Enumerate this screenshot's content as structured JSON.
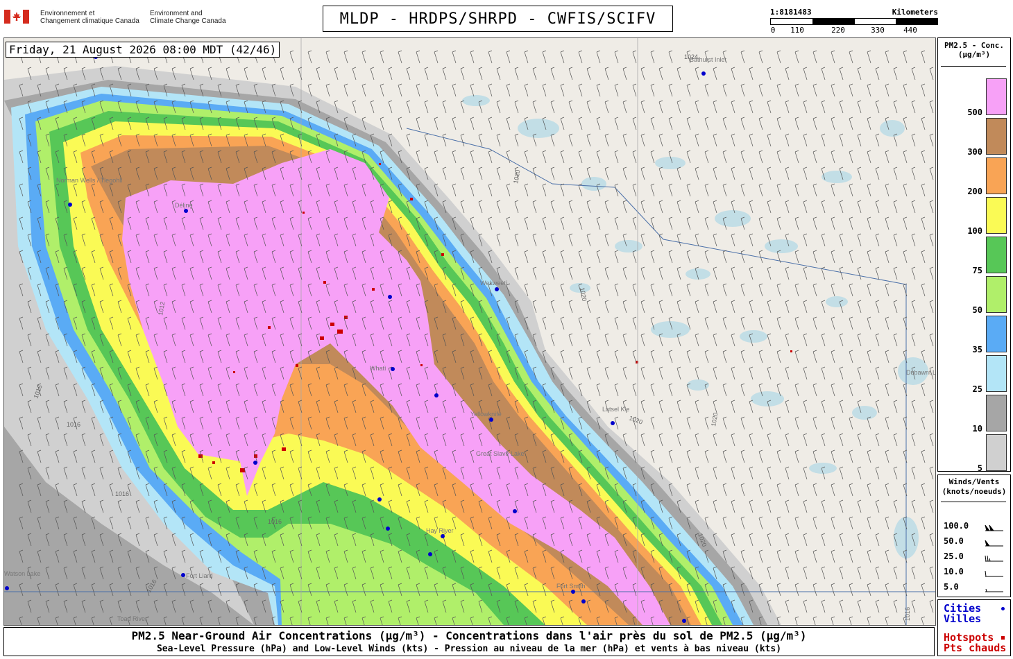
{
  "header": {
    "agency_fr_line1": "Environnement et",
    "agency_fr_line2": "Changement climatique Canada",
    "agency_en_line1": "Environment and",
    "agency_en_line2": "Climate Change Canada",
    "title": "MLDP - HRDPS/SHRPD - CWFIS/SCIFV"
  },
  "scale_bar": {
    "ratio": "1:8181483",
    "unit": "Kilometers",
    "ticks": [
      "0",
      "110",
      "220",
      "330",
      "440"
    ]
  },
  "map": {
    "datetime": "Friday, 21 August 2026 08:00 MDT (42/46)",
    "places": [
      {
        "name": "Norman Wells / Tlegohli"
      },
      {
        "name": "Délįnę"
      },
      {
        "name": "Bathurst Inlet"
      },
      {
        "name": "Wekweètì"
      },
      {
        "name": "Whatì"
      },
      {
        "name": "Yellowknife"
      },
      {
        "name": "Great Slave Lake"
      },
      {
        "name": "Hay River"
      },
      {
        "name": "Fort Liard"
      },
      {
        "name": "Fort Smith"
      },
      {
        "name": "Toad River"
      },
      {
        "name": "Dubawnt Lake"
      },
      {
        "name": "Lutsel K'e"
      },
      {
        "name": "Watson Lake"
      }
    ],
    "isobar_labels": [
      "1016",
      "1012",
      "1020",
      "1024"
    ]
  },
  "legend": {
    "title_line1": "PM2.5 - Conc.",
    "title_line2": "(µg/m³)",
    "classes": [
      {
        "label": "500",
        "color": "#f7a1f7"
      },
      {
        "label": "300",
        "color": "#c18a5a"
      },
      {
        "label": "200",
        "color": "#f9a455"
      },
      {
        "label": "100",
        "color": "#fafa55"
      },
      {
        "label": "75",
        "color": "#57c757"
      },
      {
        "label": "50",
        "color": "#b0ef6a"
      },
      {
        "label": "35",
        "color": "#5aabf5"
      },
      {
        "label": "25",
        "color": "#b3e5f7"
      },
      {
        "label": "10",
        "color": "#a6a6a6"
      },
      {
        "label": "5",
        "color": "#d0d0d0"
      }
    ]
  },
  "winds_legend": {
    "title_line1": "Winds/Vents",
    "title_line2": "(knots/noeuds)",
    "rows": [
      {
        "label": "100.0"
      },
      {
        "label": "50.0"
      },
      {
        "label": "25.0"
      },
      {
        "label": "10.0"
      },
      {
        "label": "5.0"
      }
    ]
  },
  "cities_legend": {
    "cities_line1": "Cities",
    "cities_line2": "Villes",
    "hotspots_line1": "Hotspots",
    "hotspots_line2": "Pts chauds",
    "city_color": "#0000cc",
    "hotspot_color": "#cc0000"
  },
  "footer": {
    "line1": "PM2.5 Near-Ground Air Concentrations (µg/m³) - Concentrations dans l'air près du sol de PM2.5 (µg/m³)",
    "line2": "Sea-Level Pressure (hPa) and Low-Level Winds (kts) - Pression au niveau de la mer (hPa) et vents à bas niveau (kts)"
  }
}
